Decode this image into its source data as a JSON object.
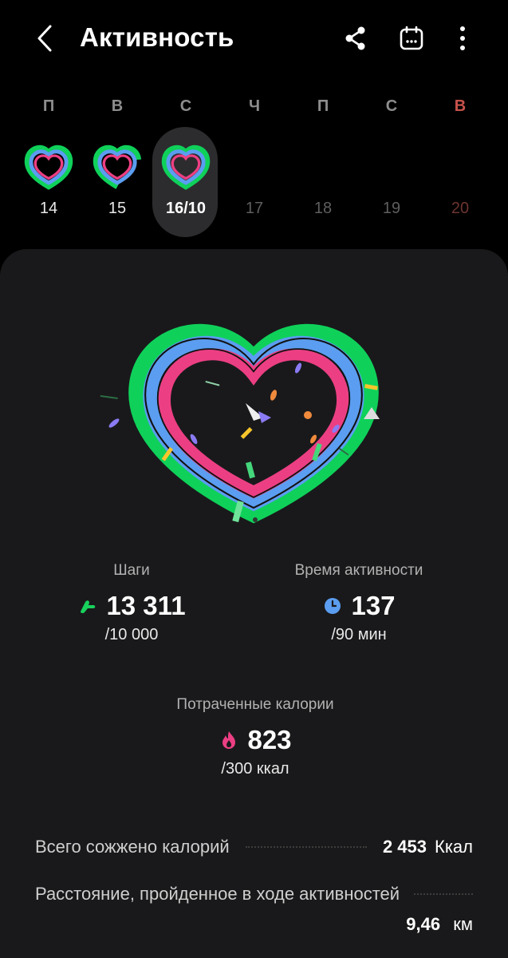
{
  "header": {
    "title": "Активность",
    "icons": {
      "back": "chevron-left-icon",
      "share": "share-icon",
      "calendar": "calendar-icon",
      "more": "more-vertical-icon"
    }
  },
  "week": {
    "days": [
      {
        "letter": "П",
        "number": "14",
        "has_ring": true,
        "state": "past"
      },
      {
        "letter": "В",
        "number": "15",
        "has_ring": true,
        "state": "past"
      },
      {
        "letter": "С",
        "number": "16/10",
        "has_ring": true,
        "state": "selected"
      },
      {
        "letter": "Ч",
        "number": "17",
        "has_ring": false,
        "state": "future"
      },
      {
        "letter": "П",
        "number": "18",
        "has_ring": false,
        "state": "future"
      },
      {
        "letter": "С",
        "number": "19",
        "has_ring": false,
        "state": "future"
      },
      {
        "letter": "В",
        "number": "20",
        "has_ring": false,
        "state": "future-sunday"
      }
    ]
  },
  "rings": {
    "colors": {
      "steps": "#0fd15a",
      "active_time": "#5b9df0",
      "calories": "#ec3f83"
    }
  },
  "stats": {
    "steps": {
      "label": "Шаги",
      "value": "13 311",
      "goal": "/10 000",
      "icon": "shoe-icon",
      "color": "#18d05c"
    },
    "active_time": {
      "label": "Время активности",
      "value": "137",
      "goal": "/90 мин",
      "icon": "clock-icon",
      "color": "#5b9df0"
    },
    "calories": {
      "label": "Потраченные калории",
      "value": "823",
      "goal": "/300 ккал",
      "icon": "flame-icon",
      "color": "#ec3f83"
    }
  },
  "summary": {
    "total_calories": {
      "label": "Всего сожжено калорий",
      "value": "2 453",
      "unit": "Ккал"
    },
    "distance": {
      "label": "Расстояние, пройденное в ходе активностей",
      "value": "9,46",
      "unit": "км"
    }
  }
}
